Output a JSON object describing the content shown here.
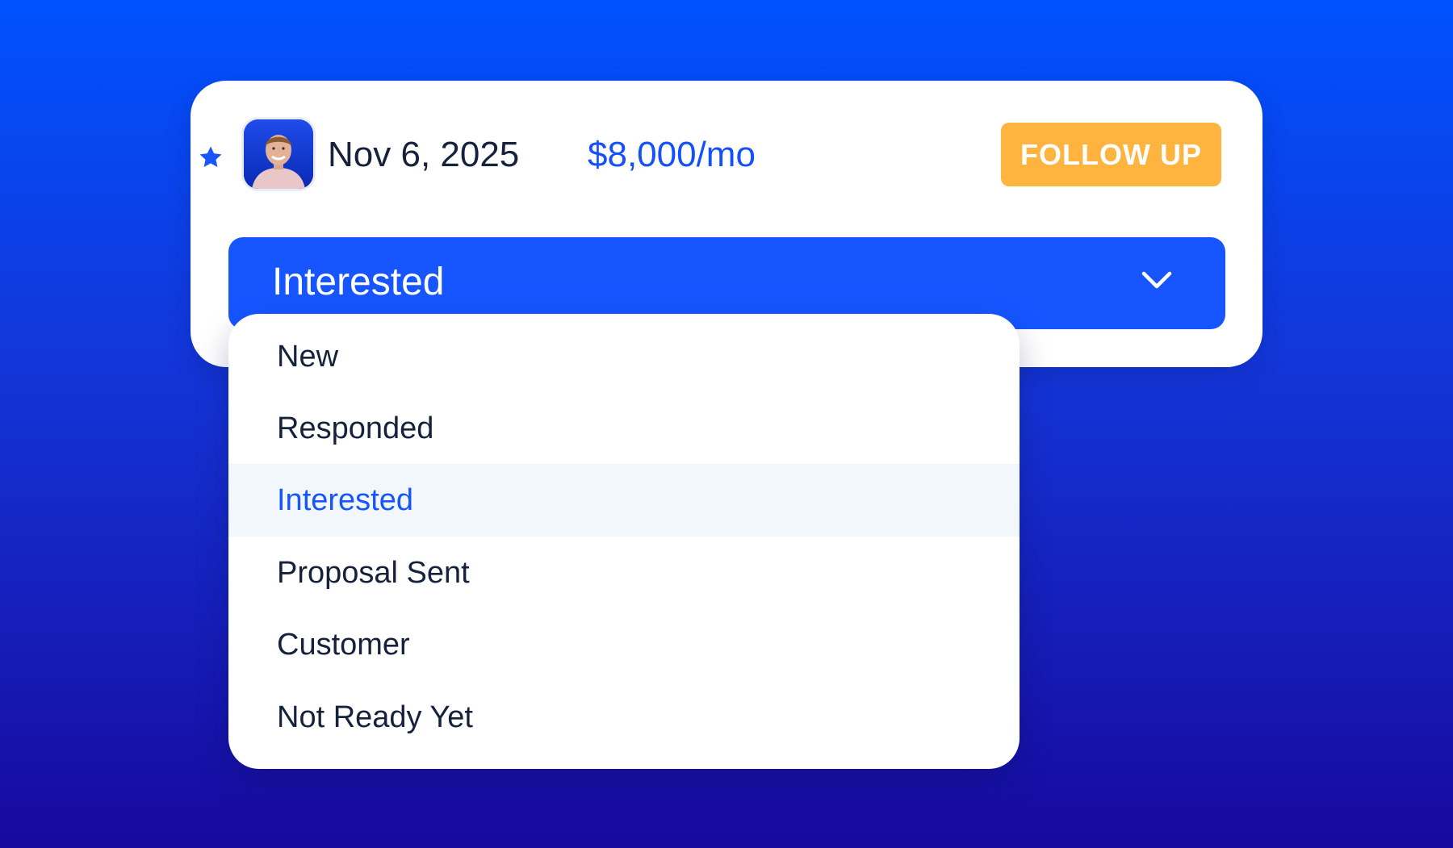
{
  "lead_card": {
    "starred": true,
    "date": "Nov 6, 2025",
    "price": "$8,000/mo",
    "follow_up_label": "FOLLOW UP"
  },
  "status_select": {
    "selected_value": "Interested",
    "options": [
      {
        "label": "New",
        "selected": false
      },
      {
        "label": "Responded",
        "selected": false
      },
      {
        "label": "Interested",
        "selected": true
      },
      {
        "label": "Proposal Sent",
        "selected": false
      },
      {
        "label": "Customer",
        "selected": false
      },
      {
        "label": "Not Ready Yet",
        "selected": false
      }
    ]
  },
  "colors": {
    "accent_blue": "#1655FF",
    "follow_up_orange": "#FFB43F",
    "text_dark": "#16223B",
    "highlight_row": "#F2F7FE"
  }
}
